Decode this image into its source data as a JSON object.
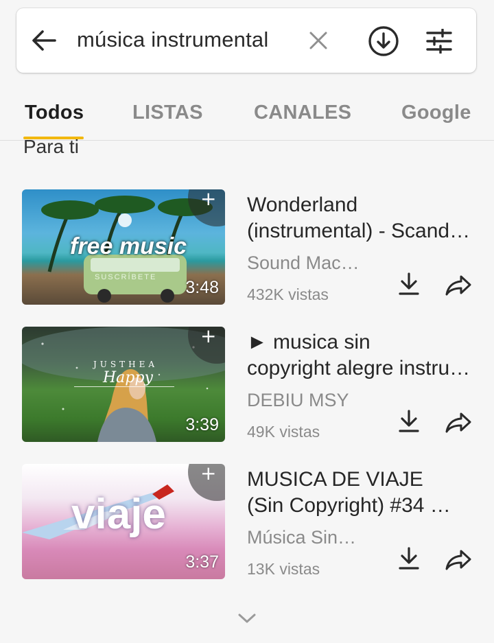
{
  "search": {
    "query": "música instrumental",
    "back_icon": "arrow-left-icon",
    "clear_icon": "close-icon",
    "download_icon": "circle-download-icon",
    "filter_icon": "tune-sliders-icon"
  },
  "tabs": [
    {
      "label": "Todos",
      "active": true
    },
    {
      "label": "LISTAS",
      "active": false
    },
    {
      "label": "CANALES",
      "active": false
    },
    {
      "label": "Google",
      "active": false
    }
  ],
  "accent_color": "#f2b80f",
  "section_label": "Para ti",
  "results": [
    {
      "title_line1": "Wonderland",
      "title_line2": "(instrumental) - Scandinavianz",
      "channel": "Sound Mac…",
      "views": "432K vistas",
      "duration": "3:48",
      "thumb_text": "free music",
      "thumb_subtext": "SUSCRÍBETE"
    },
    {
      "title_line1": "► musica sin",
      "title_line2": "copyright alegre instrumental",
      "channel": "DEBIU MSY",
      "views": "49K vistas",
      "duration": "3:39",
      "thumb_text": "Happy",
      "thumb_subtext": "JUSTHEA"
    },
    {
      "title_line1": "MUSICA DE VIAJE",
      "title_line2": "(Sin Copyright) #34 …",
      "channel": "Música Sin…",
      "views": "13K vistas",
      "duration": "3:37",
      "thumb_text": "viaje",
      "thumb_subtext": ""
    }
  ]
}
